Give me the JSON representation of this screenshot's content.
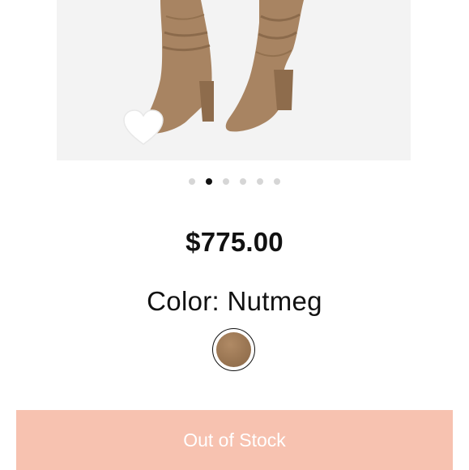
{
  "product": {
    "price": "$775.00",
    "color_label": "Color: Nutmeg",
    "swatch_color": "#9a7653",
    "stock_button_label": "Out of Stock",
    "stock_button_color": "#f7c2b0"
  },
  "gallery": {
    "slide_count": 6,
    "active_slide": 2,
    "favorite_icon": "heart-outline-icon"
  }
}
